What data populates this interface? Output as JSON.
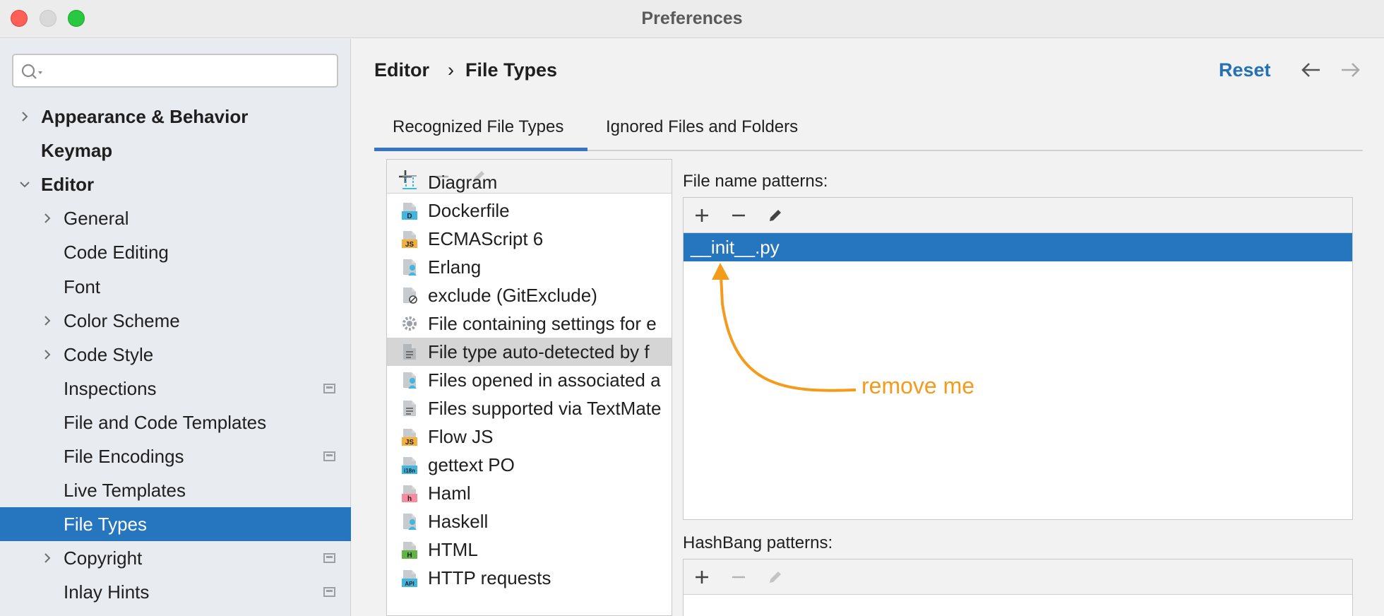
{
  "window": {
    "title": "Preferences"
  },
  "search": {
    "value": "",
    "placeholder": ""
  },
  "sidebar": {
    "items": [
      {
        "label": "Appearance & Behavior",
        "level": 0,
        "bold": true,
        "expandable": true,
        "expanded": false
      },
      {
        "label": "Keymap",
        "level": 0,
        "bold": true,
        "expandable": false
      },
      {
        "label": "Editor",
        "level": 0,
        "bold": true,
        "expandable": true,
        "expanded": true
      },
      {
        "label": "General",
        "level": 1,
        "expandable": true,
        "expanded": false
      },
      {
        "label": "Code Editing",
        "level": 1
      },
      {
        "label": "Font",
        "level": 1
      },
      {
        "label": "Color Scheme",
        "level": 1,
        "expandable": true,
        "expanded": false
      },
      {
        "label": "Code Style",
        "level": 1,
        "expandable": true,
        "expanded": false
      },
      {
        "label": "Inspections",
        "level": 1,
        "project_icon": true
      },
      {
        "label": "File and Code Templates",
        "level": 1
      },
      {
        "label": "File Encodings",
        "level": 1,
        "project_icon": true
      },
      {
        "label": "Live Templates",
        "level": 1
      },
      {
        "label": "File Types",
        "level": 1,
        "selected": true
      },
      {
        "label": "Copyright",
        "level": 1,
        "expandable": true,
        "expanded": false,
        "project_icon": true
      },
      {
        "label": "Inlay Hints",
        "level": 1,
        "project_icon": true
      }
    ]
  },
  "breadcrumb": {
    "parent": "Editor",
    "separator": "›",
    "current": "File Types"
  },
  "toolbar": {
    "reset_label": "Reset"
  },
  "tabs": [
    {
      "label": "Recognized File Types",
      "active": true
    },
    {
      "label": "Ignored Files and Folders",
      "active": false
    }
  ],
  "file_types": [
    {
      "label": "Diagram",
      "icon": "diagram-icon"
    },
    {
      "label": "Dockerfile",
      "icon": "dockerfile-icon",
      "badge": "D"
    },
    {
      "label": "ECMAScript 6",
      "icon": "js-file-icon",
      "badge": "JS"
    },
    {
      "label": "Erlang",
      "icon": "erlang-icon"
    },
    {
      "label": "exclude (GitExclude)",
      "icon": "git-exclude-icon"
    },
    {
      "label": "File containing settings for e",
      "icon": "gear-icon"
    },
    {
      "label": "File type auto-detected by f",
      "icon": "text-file-icon",
      "selected": true
    },
    {
      "label": "Files opened in associated a",
      "icon": "person-file-icon"
    },
    {
      "label": "Files supported via TextMate",
      "icon": "text-file-icon"
    },
    {
      "label": "Flow JS",
      "icon": "js-file-icon",
      "badge": "JS"
    },
    {
      "label": "gettext PO",
      "icon": "i18n-file-icon",
      "badge": "i18n"
    },
    {
      "label": "Haml",
      "icon": "haml-file-icon",
      "badge": "h"
    },
    {
      "label": "Haskell",
      "icon": "haskell-file-icon"
    },
    {
      "label": "HTML",
      "icon": "html-file-icon",
      "badge": "H"
    },
    {
      "label": "HTTP requests",
      "icon": "api-file-icon",
      "badge": "API"
    }
  ],
  "file_name_patterns": {
    "label": "File name patterns:",
    "items": [
      {
        "value": "__init__.py",
        "selected": true
      }
    ]
  },
  "hashbang_patterns": {
    "label": "HashBang patterns:",
    "items": []
  },
  "annotation": {
    "text": "remove me"
  },
  "colors": {
    "accent": "#2675bf",
    "annotation": "#f59b1c",
    "link": "#2470b3"
  }
}
